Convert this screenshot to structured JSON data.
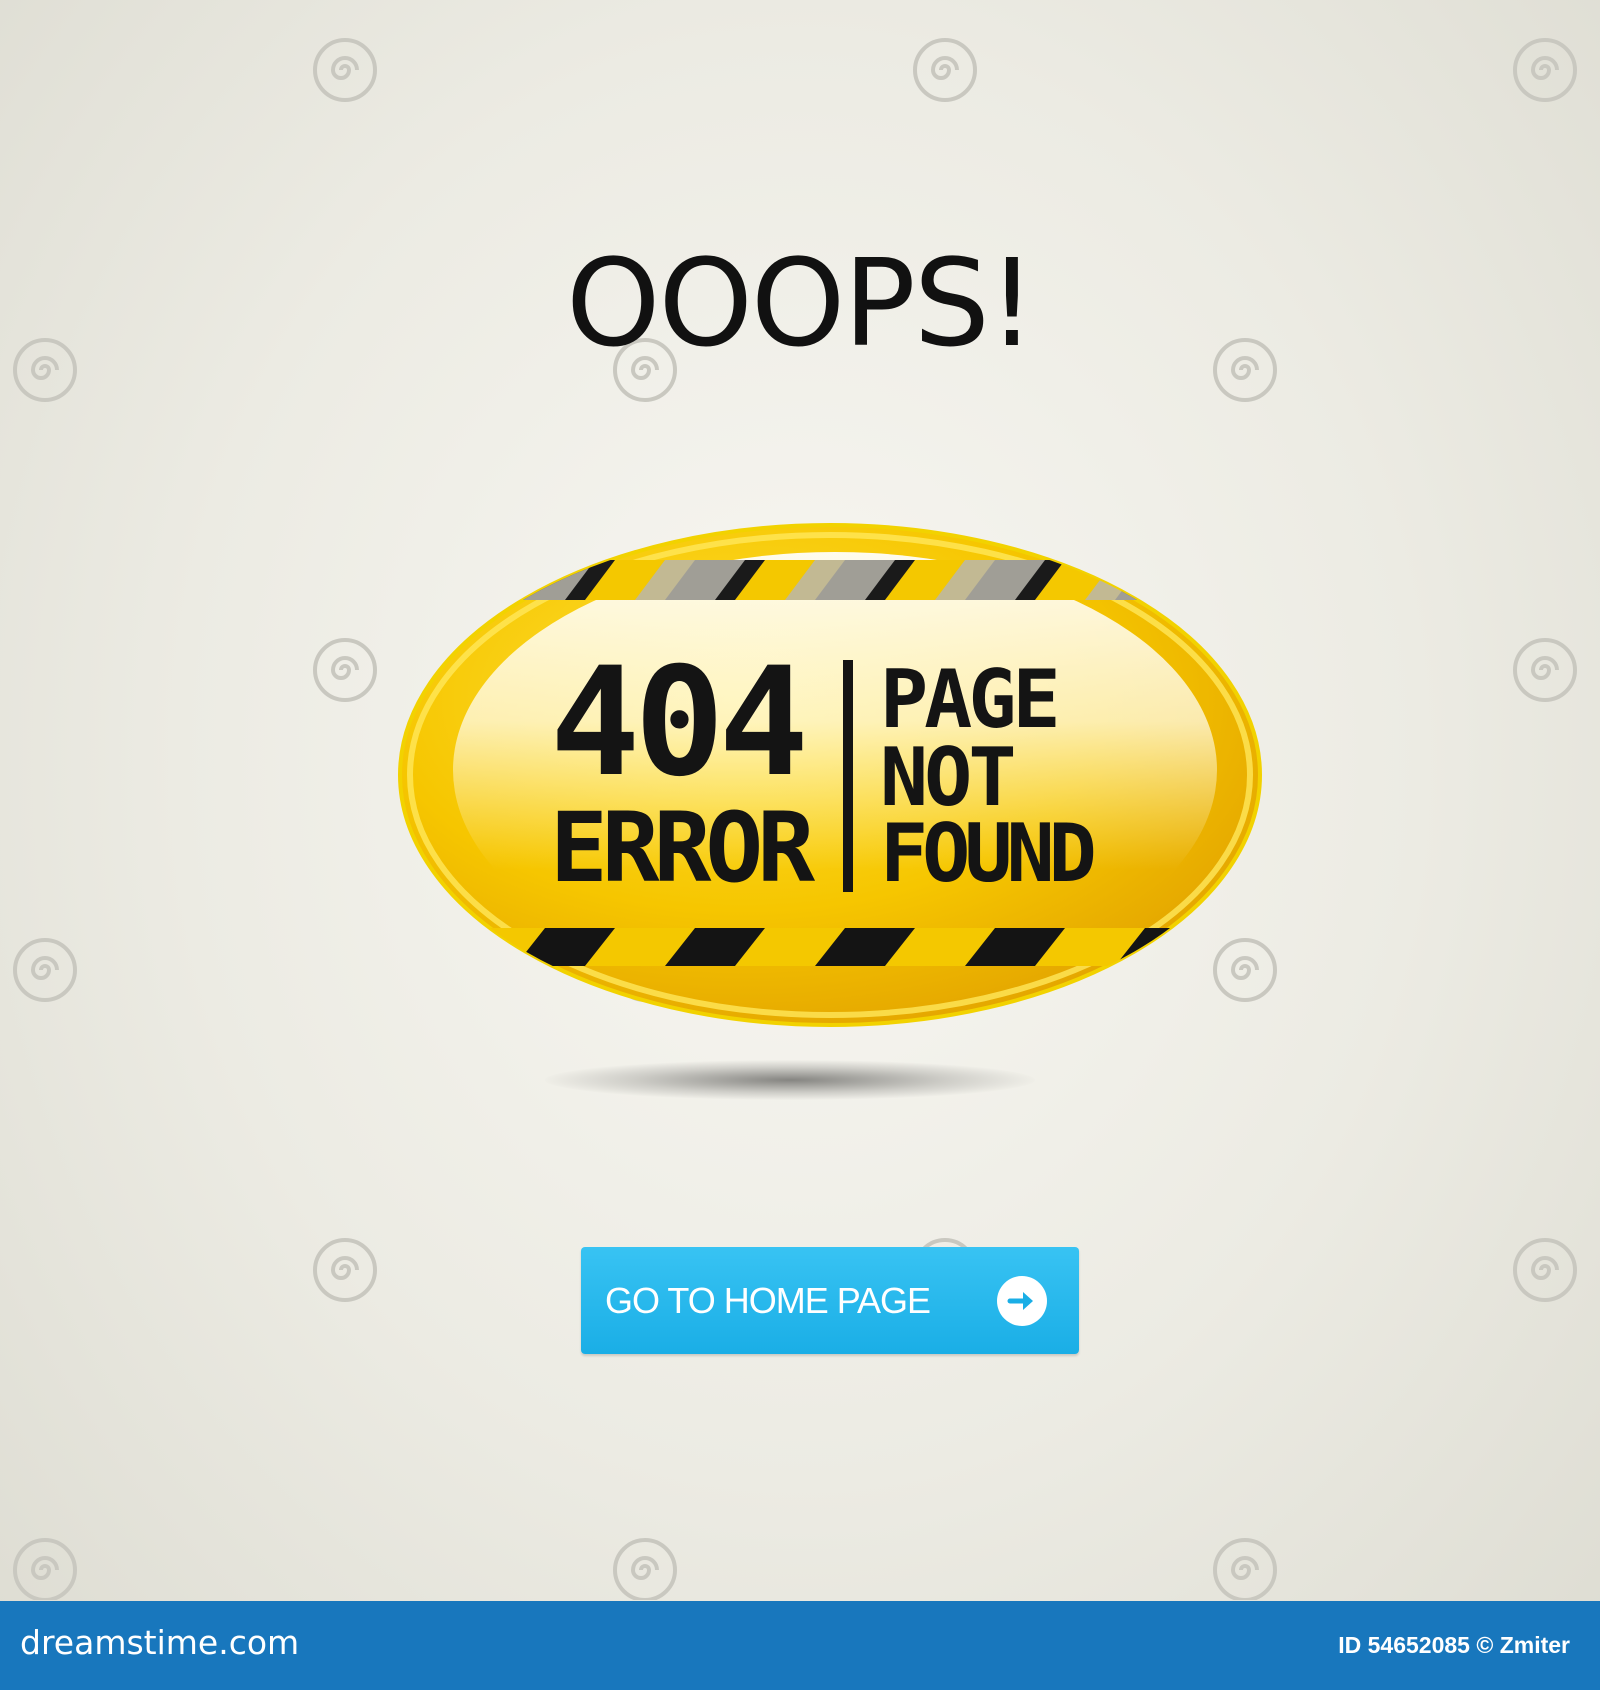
{
  "headline": "OOOPS!",
  "sign": {
    "code": "404",
    "code_label": "ERROR",
    "message_lines": [
      "PAGE",
      "NOT",
      "FOUND"
    ],
    "colors": {
      "yellow": "#f5c400",
      "stripe": "#141414"
    }
  },
  "home_button": {
    "label": "GO TO HOME PAGE",
    "icon": "arrow-right-circle-icon",
    "color": "#1fb3ea"
  },
  "footer": {
    "site": "dreamstime.com",
    "image_id": "ID 54652085 © Zmiter",
    "color": "#1877bd"
  },
  "watermark": {
    "icon": "spiral-logo-icon",
    "text": "dreamstime"
  }
}
